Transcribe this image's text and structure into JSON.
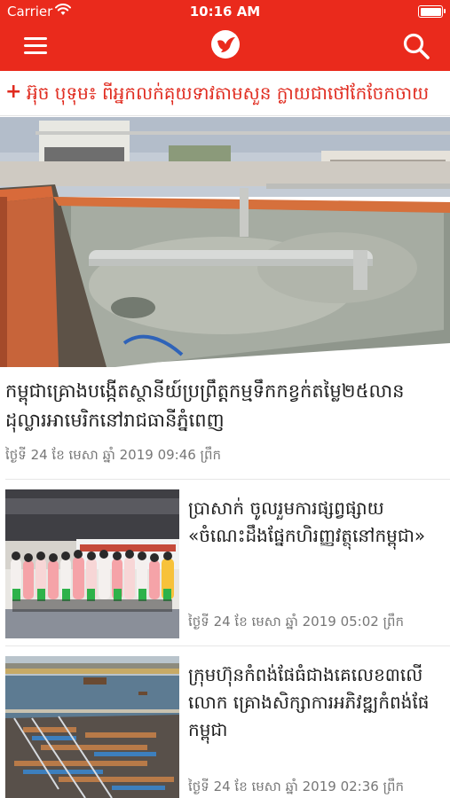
{
  "status": {
    "carrier": "Carrier",
    "time": "10:16 AM"
  },
  "header": {
    "menu_icon": "hamburger-menu-icon",
    "logo_icon": "bird-logo-icon",
    "search_icon": "search-icon",
    "brand_color": "#ea2a1c"
  },
  "ticker": {
    "icon": "+",
    "text": "អ៊ុច បុទុម៖ ពីអ្នកលក់គុយទាវតាមសួន ក្លាយជាថៅកែចែកចាយ"
  },
  "featured": {
    "title": "កម្ពុជាគ្រោងបង្កើតស្ថានីយ៍ប្រព្រឹត្តកម្មទឹកកខ្វក់តម្លៃ២៥លានដុល្លារអាមេរិកនៅរាជធានីភ្នំពេញ",
    "timestamp": "ថ្ងៃទី 24 ខែ មេសា ឆ្នាំ 2019 09:46 ព្រឹក"
  },
  "articles": [
    {
      "title": "ប្រាសាក់ ចូលរួមការផ្សព្វផ្សាយ «ចំណេះដឹងផ្នែកហិរញ្ញវត្ថុនៅកម្ពុជា»",
      "timestamp": "ថ្ងៃទី 24 ខែ មេសា ឆ្នាំ 2019 05:02 ព្រឹក"
    },
    {
      "title": "ក្រុមហ៊ុនកំពង់ផែធំជាងគេលេខ៣លើលោក គ្រោងសិក្សាការអភិវឌ្ឍកំពង់ផែកម្ពុជា",
      "timestamp": "ថ្ងៃទី 24 ខែ មេសា ឆ្នាំ 2019 02:36 ព្រឹក"
    }
  ]
}
